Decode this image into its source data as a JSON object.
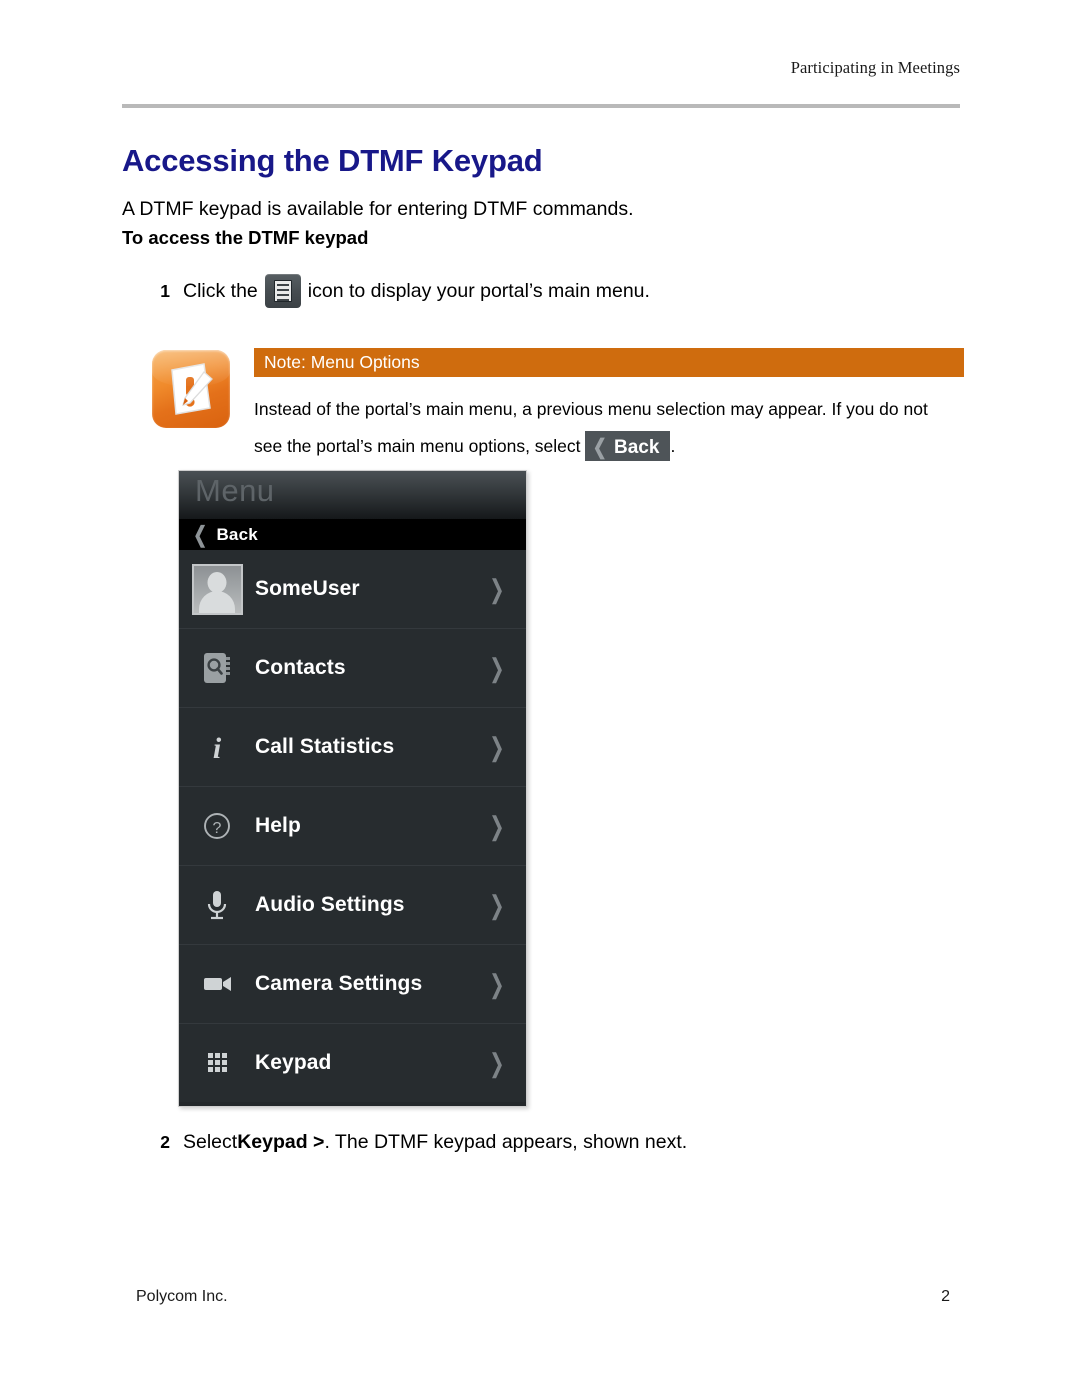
{
  "document": {
    "running_header": "Participating in Meetings",
    "title": "Accessing the DTMF Keypad",
    "intro": "A DTMF keypad is available for entering DTMF commands.",
    "sub_heading": "To access the DTMF keypad",
    "accent_color": "#181889",
    "rule_color": "#b9b9b9"
  },
  "steps": {
    "one": {
      "number": "1",
      "text_before_icon": "Click the",
      "icon": "menu-list-icon",
      "text_after_icon": "icon to display your portal’s main menu."
    },
    "two": {
      "number": "2",
      "text_before_bold": "Select ",
      "bold_text": "Keypad >",
      "text_after_bold": ". The DTMF keypad appears, shown next."
    }
  },
  "note": {
    "icon": "note-pencil-icon",
    "bar_color": "#cf6c0e",
    "bar_label": "Note: Menu Options",
    "line1": "Instead of the portal’s main menu, a previous menu selection may appear. If you do not",
    "line2_before_button": "see the portal’s main menu options, select",
    "button_label": "Back",
    "line2_after_button": "."
  },
  "menu_screenshot": {
    "title": "Menu",
    "back_label": "Back",
    "rows": [
      {
        "label": "SomeUser",
        "icon": "avatar-thumbnail",
        "chevron": "chevron-right-icon"
      },
      {
        "label": "Contacts",
        "icon": "address-book-icon",
        "chevron": "chevron-right-icon"
      },
      {
        "label": "Call Statistics",
        "icon": "info-icon",
        "chevron": "chevron-right-icon"
      },
      {
        "label": "Help",
        "icon": "question-circle-icon",
        "chevron": "chevron-right-icon"
      },
      {
        "label": "Audio Settings",
        "icon": "microphone-icon",
        "chevron": "chevron-right-icon"
      },
      {
        "label": "Camera Settings",
        "icon": "video-camera-icon",
        "chevron": "chevron-right-icon"
      },
      {
        "label": "Keypad",
        "icon": "keypad-grid-icon",
        "chevron": "chevron-right-icon"
      }
    ]
  },
  "footer": {
    "left": "Polycom Inc.",
    "page_number": "2"
  }
}
